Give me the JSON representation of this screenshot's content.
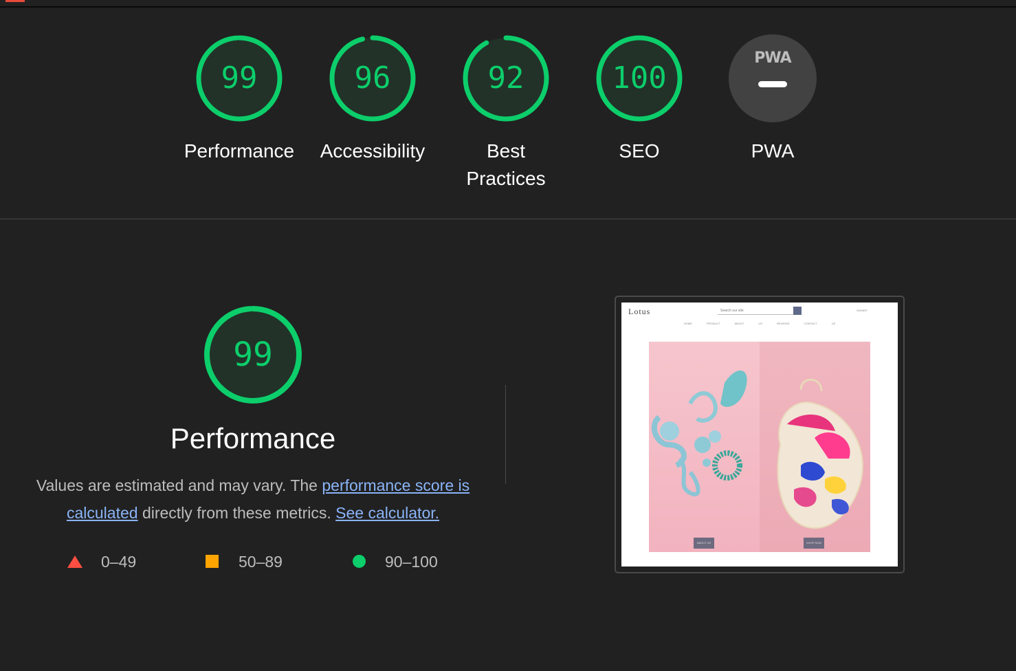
{
  "colors": {
    "background": "#212121",
    "pass": "#0cce6b",
    "average": "#ffa400",
    "fail": "#ff4e42",
    "link": "#8ab4f8"
  },
  "categories": [
    {
      "score": "99",
      "label": "Performance",
      "value": 0.99
    },
    {
      "score": "96",
      "label": "Accessibility",
      "value": 0.96
    },
    {
      "score": "92",
      "label": "Best Practices",
      "value": 0.92
    },
    {
      "score": "100",
      "label": "SEO",
      "value": 1.0
    }
  ],
  "pwa": {
    "badge_text": "PWA",
    "label": "PWA"
  },
  "performance": {
    "score": "99",
    "value": 0.99,
    "title": "Performance",
    "desc_prefix": "Values are estimated and may vary. The ",
    "desc_link1": "performance score is calculated",
    "desc_middle": " directly from these metrics. ",
    "desc_link2": "See calculator."
  },
  "legend": {
    "fail": "0–49",
    "average": "50–89",
    "pass": "90–100"
  },
  "screenshot": {
    "logo": "Lotus",
    "search_placeholder": "Search our site",
    "owner": "OWNER",
    "nav": "HOME PRODUCT ABOUT US REVIEWS CONTACT US",
    "button_about": "ABOUT US",
    "button_shop": "SHOP NOW"
  }
}
